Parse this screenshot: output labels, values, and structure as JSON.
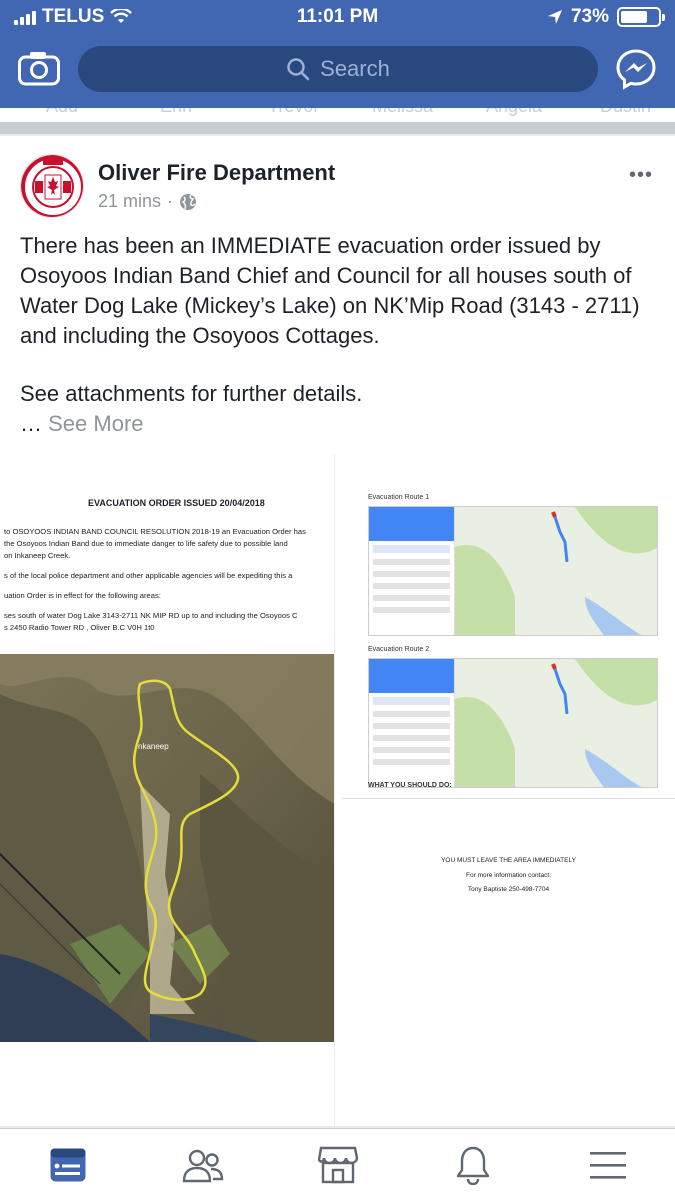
{
  "status_bar": {
    "carrier": "TELUS",
    "time": "11:01 PM",
    "battery": "73%",
    "battery_level": 0.73
  },
  "header": {
    "search_placeholder": "Search",
    "camera_icon": "camera-icon",
    "messenger_icon": "messenger-icon"
  },
  "stories": {
    "names": [
      "Add",
      "Erin",
      "Trevor",
      "Melissa",
      "Angela",
      "Dustin"
    ]
  },
  "post": {
    "author": "Oliver Fire Department",
    "time": "21 mins",
    "privacy_icon": "globe-icon",
    "more": "•••",
    "body_1": "There has been an IMMEDIATE evacuation order issued by Osoyoos Indian Band Chief and Council for all houses south of Water Dog Lake (Mickey’s Lake) on NK’Mip Road (3143 - 2711) and including the Osoyoos Cottages.",
    "body_2": "See attachments for further details.",
    "ellipsis": "…",
    "see_more": "See More"
  },
  "attachment_1": {
    "title": "EVACUATION ORDER ISSUED 20/04/2018",
    "lines": [
      "to OSOYOOS INDIAN BAND COUNCIL RESOLUTION 2018-19 an Evacuation Order has",
      "the Osoyoos Indian Band due to immediate danger to life safety due to possible land",
      " on Inkaneep Creek.",
      "s of the local police department and other applicable agencies will be expediting this a",
      "uation Order is in effect for the following areas:",
      "ses south of water Dog Lake 3143-2711 NK MIP RD up to and including the Osoyoos C",
      "s  2450 Radio Tower RD , Oliver B.C V0H 1t0"
    ],
    "map_label": "nkaneep"
  },
  "attachment_2": {
    "route1": "Evacuation Route 1",
    "route2": "Evacuation Route 2",
    "what_to_do": "WHAT YOU SHOULD DO:"
  },
  "attachment_3": {
    "line1": "YOU MUST LEAVE THE AREA IMMEDIATELY",
    "line2": "For more information contact:",
    "line3": "Tony Baptiste 250-498-7704"
  },
  "tabbar": {
    "items": [
      "news-feed-icon",
      "friends-icon",
      "marketplace-icon",
      "notifications-icon",
      "menu-icon"
    ],
    "active": "news-feed-icon",
    "active_color": "#4267b2",
    "inactive_color": "#606770"
  }
}
